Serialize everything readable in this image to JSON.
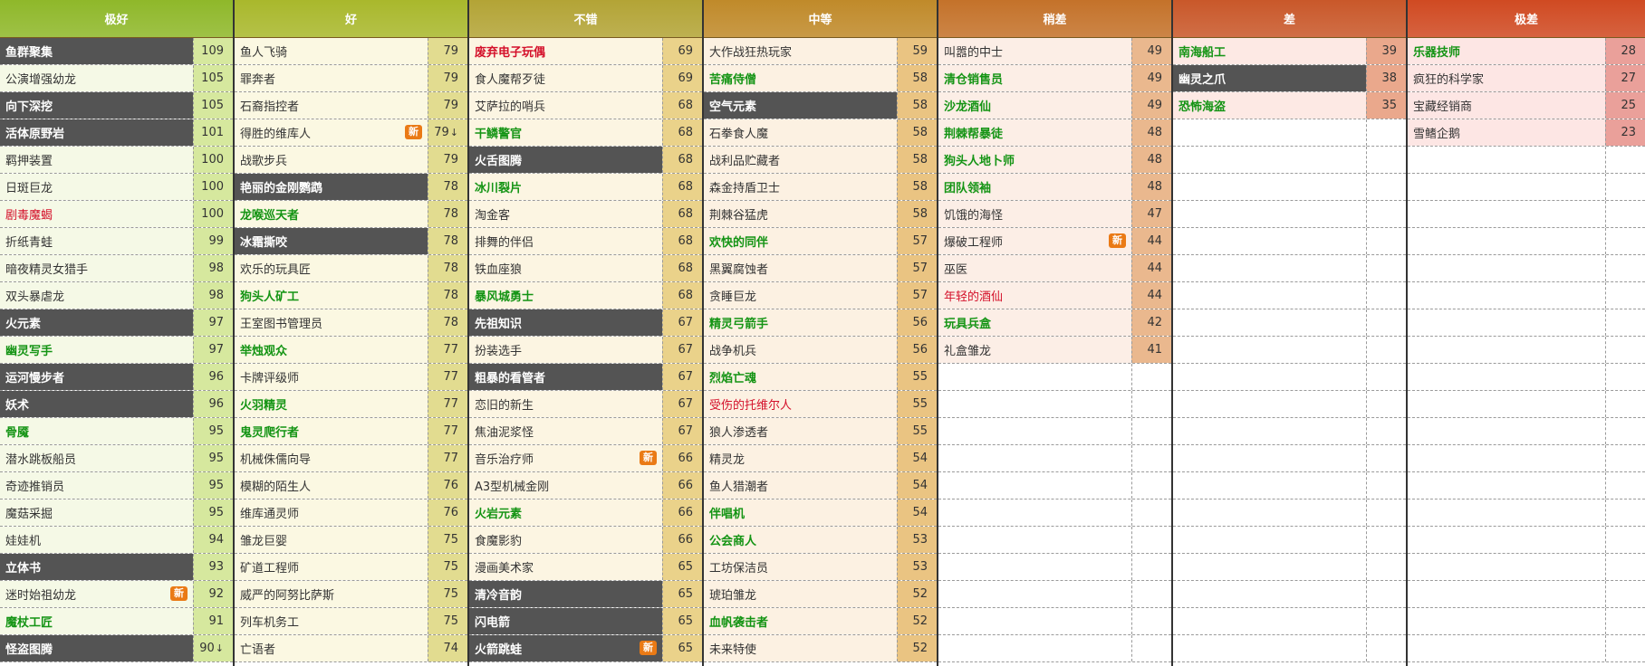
{
  "tiers": [
    {
      "label": "极好",
      "header_color": "#8fb82a",
      "name_bg": "#f5f9e6",
      "score_bg": "#d6e89e",
      "items": [
        {
          "name": "鱼群聚集",
          "score": "109",
          "style": "dark"
        },
        {
          "name": "公演增强幼龙",
          "score": "105",
          "style": ""
        },
        {
          "name": "向下深挖",
          "score": "105",
          "style": "dark"
        },
        {
          "name": "活体原野岩",
          "score": "101",
          "style": "dark"
        },
        {
          "name": "羁押装置",
          "score": "100",
          "style": ""
        },
        {
          "name": "日斑巨龙",
          "score": "100",
          "style": ""
        },
        {
          "name": "剧毒魔蝎",
          "score": "100",
          "style": "red"
        },
        {
          "name": "折纸青蛙",
          "score": "99",
          "style": ""
        },
        {
          "name": "暗夜精灵女猎手",
          "score": "98",
          "style": ""
        },
        {
          "name": "双头暴虐龙",
          "score": "98",
          "style": ""
        },
        {
          "name": "火元素",
          "score": "97",
          "style": "dark"
        },
        {
          "name": "幽灵写手",
          "score": "97",
          "style": "green"
        },
        {
          "name": "运河慢步者",
          "score": "96",
          "style": "dark"
        },
        {
          "name": "妖术",
          "score": "96",
          "style": "dark"
        },
        {
          "name": "骨魇",
          "score": "95",
          "style": "green"
        },
        {
          "name": "潜水跳板船员",
          "score": "95",
          "style": ""
        },
        {
          "name": "奇迹推销员",
          "score": "95",
          "style": ""
        },
        {
          "name": "魔菇采掘",
          "score": "95",
          "style": ""
        },
        {
          "name": "娃娃机",
          "score": "94",
          "style": ""
        },
        {
          "name": "立体书",
          "score": "93",
          "style": "dark"
        },
        {
          "name": "迷时始祖幼龙",
          "score": "92",
          "style": "",
          "badge": "新"
        },
        {
          "name": "魔杖工匠",
          "score": "91",
          "style": "green"
        },
        {
          "name": "怪盗图腾",
          "score": "90",
          "style": "dark",
          "trend": "↓"
        }
      ]
    },
    {
      "label": "好",
      "header_color": "#a9b82c",
      "name_bg": "#fbf8e2",
      "score_bg": "#e2dc90",
      "items": [
        {
          "name": "鱼人飞骑",
          "score": "79",
          "style": ""
        },
        {
          "name": "罪奔者",
          "score": "79",
          "style": ""
        },
        {
          "name": "石裔指控者",
          "score": "79",
          "style": ""
        },
        {
          "name": "得胜的维库人",
          "score": "79",
          "style": "",
          "badge": "新",
          "trend": "↓"
        },
        {
          "name": "战歌步兵",
          "score": "79",
          "style": ""
        },
        {
          "name": "艳丽的金刚鹦鹉",
          "score": "78",
          "style": "dark"
        },
        {
          "name": "龙喉巡天者",
          "score": "78",
          "style": "green"
        },
        {
          "name": "冰霜撕咬",
          "score": "78",
          "style": "dark"
        },
        {
          "name": "欢乐的玩具匠",
          "score": "78",
          "style": ""
        },
        {
          "name": "狗头人矿工",
          "score": "78",
          "style": "green"
        },
        {
          "name": "王室图书管理员",
          "score": "78",
          "style": ""
        },
        {
          "name": "举烛观众",
          "score": "77",
          "style": "green"
        },
        {
          "name": "卡牌评级师",
          "score": "77",
          "style": ""
        },
        {
          "name": "火羽精灵",
          "score": "77",
          "style": "green"
        },
        {
          "name": "鬼灵爬行者",
          "score": "77",
          "style": "green"
        },
        {
          "name": "机械侏儒向导",
          "score": "77",
          "style": ""
        },
        {
          "name": "模糊的陌生人",
          "score": "76",
          "style": ""
        },
        {
          "name": "维库通灵师",
          "score": "76",
          "style": ""
        },
        {
          "name": "雏龙巨婴",
          "score": "75",
          "style": ""
        },
        {
          "name": "矿道工程师",
          "score": "75",
          "style": ""
        },
        {
          "name": "威严的阿努比萨斯",
          "score": "75",
          "style": ""
        },
        {
          "name": "列车机务工",
          "score": "75",
          "style": ""
        },
        {
          "name": "亡语者",
          "score": "74",
          "style": ""
        }
      ]
    },
    {
      "label": "不错",
      "header_color": "#b3a436",
      "name_bg": "#fcf5e2",
      "score_bg": "#ead28a",
      "items": [
        {
          "name": "废弃电子玩偶",
          "score": "69",
          "style": "redbold"
        },
        {
          "name": "食人魔帮歹徒",
          "score": "69",
          "style": ""
        },
        {
          "name": "艾萨拉的哨兵",
          "score": "68",
          "style": ""
        },
        {
          "name": "干鳞警官",
          "score": "68",
          "style": "green"
        },
        {
          "name": "火舌图腾",
          "score": "68",
          "style": "dark"
        },
        {
          "name": "冰川裂片",
          "score": "68",
          "style": "green"
        },
        {
          "name": "淘金客",
          "score": "68",
          "style": ""
        },
        {
          "name": "排舞的伴侣",
          "score": "68",
          "style": ""
        },
        {
          "name": "铁血座狼",
          "score": "68",
          "style": ""
        },
        {
          "name": "暴风城勇士",
          "score": "68",
          "style": "green"
        },
        {
          "name": "先祖知识",
          "score": "67",
          "style": "dark"
        },
        {
          "name": "扮装选手",
          "score": "67",
          "style": ""
        },
        {
          "name": "粗暴的看管者",
          "score": "67",
          "style": "dark"
        },
        {
          "name": "恋旧的新生",
          "score": "67",
          "style": ""
        },
        {
          "name": "焦油泥浆怪",
          "score": "67",
          "style": ""
        },
        {
          "name": "音乐治疗师",
          "score": "66",
          "style": "",
          "badge": "新"
        },
        {
          "name": "A3型机械金刚",
          "score": "66",
          "style": ""
        },
        {
          "name": "火岩元素",
          "score": "66",
          "style": "green"
        },
        {
          "name": "食魔影豹",
          "score": "66",
          "style": ""
        },
        {
          "name": "漫画美术家",
          "score": "65",
          "style": ""
        },
        {
          "name": "清冷音韵",
          "score": "65",
          "style": "dark"
        },
        {
          "name": "闪电箭",
          "score": "65",
          "style": "dark"
        },
        {
          "name": "火箭跳蛙",
          "score": "65",
          "style": "dark",
          "badge": "新"
        }
      ]
    },
    {
      "label": "中等",
      "header_color": "#c08a2a",
      "name_bg": "#fcf1e2",
      "score_bg": "#eac482",
      "items": [
        {
          "name": "大作战狂热玩家",
          "score": "59",
          "style": ""
        },
        {
          "name": "苦痛侍僧",
          "score": "58",
          "style": "green"
        },
        {
          "name": "空气元素",
          "score": "58",
          "style": "dark"
        },
        {
          "name": "石拳食人魔",
          "score": "58",
          "style": ""
        },
        {
          "name": "战利品贮藏者",
          "score": "58",
          "style": ""
        },
        {
          "name": "森金持盾卫士",
          "score": "58",
          "style": ""
        },
        {
          "name": "荆棘谷猛虎",
          "score": "58",
          "style": ""
        },
        {
          "name": "欢快的同伴",
          "score": "57",
          "style": "green"
        },
        {
          "name": "黑翼腐蚀者",
          "score": "57",
          "style": ""
        },
        {
          "name": "贪睡巨龙",
          "score": "57",
          "style": ""
        },
        {
          "name": "精灵弓箭手",
          "score": "56",
          "style": "green"
        },
        {
          "name": "战争机兵",
          "score": "56",
          "style": ""
        },
        {
          "name": "烈焰亡魂",
          "score": "55",
          "style": "green"
        },
        {
          "name": "受伤的托维尔人",
          "score": "55",
          "style": "red"
        },
        {
          "name": "狼人渗透者",
          "score": "55",
          "style": ""
        },
        {
          "name": "精灵龙",
          "score": "54",
          "style": ""
        },
        {
          "name": "鱼人猎潮者",
          "score": "54",
          "style": ""
        },
        {
          "name": "伴唱机",
          "score": "54",
          "style": "green"
        },
        {
          "name": "公会商人",
          "score": "53",
          "style": "green"
        },
        {
          "name": "工坊保洁员",
          "score": "53",
          "style": ""
        },
        {
          "name": "琥珀雏龙",
          "score": "52",
          "style": ""
        },
        {
          "name": "血帆袭击者",
          "score": "52",
          "style": "green"
        },
        {
          "name": "未来特使",
          "score": "52",
          "style": ""
        }
      ]
    },
    {
      "label": "稍差",
      "header_color": "#c4722a",
      "name_bg": "#fceee6",
      "score_bg": "#eab88e",
      "items": [
        {
          "name": "叫嚣的中士",
          "score": "49",
          "style": ""
        },
        {
          "name": "清仓销售员",
          "score": "49",
          "style": "green"
        },
        {
          "name": "沙龙酒仙",
          "score": "49",
          "style": "green"
        },
        {
          "name": "荆棘帮暴徒",
          "score": "48",
          "style": "green"
        },
        {
          "name": "狗头人地卜师",
          "score": "48",
          "style": "green"
        },
        {
          "name": "团队领袖",
          "score": "48",
          "style": "green"
        },
        {
          "name": "饥饿的海怪",
          "score": "47",
          "style": ""
        },
        {
          "name": "爆破工程师",
          "score": "44",
          "style": "",
          "badge": "新"
        },
        {
          "name": "巫医",
          "score": "44",
          "style": ""
        },
        {
          "name": "年轻的酒仙",
          "score": "44",
          "style": "red"
        },
        {
          "name": "玩具兵盒",
          "score": "42",
          "style": "green"
        },
        {
          "name": "礼盒雏龙",
          "score": "41",
          "style": ""
        }
      ]
    },
    {
      "label": "差",
      "header_color": "#c9582a",
      "name_bg": "#fde9e4",
      "score_bg": "#eaa88c",
      "items": [
        {
          "name": "南海船工",
          "score": "39",
          "style": "green"
        },
        {
          "name": "幽灵之爪",
          "score": "38",
          "style": "dark"
        },
        {
          "name": "恐怖海盗",
          "score": "35",
          "style": "green"
        }
      ]
    },
    {
      "label": "极差",
      "header_color": "#d04a22",
      "name_bg": "#fde6e4",
      "score_bg": "#eaa09a",
      "items": [
        {
          "name": "乐器技师",
          "score": "28",
          "style": "green"
        },
        {
          "name": "疯狂的科学家",
          "score": "27",
          "style": ""
        },
        {
          "name": "宝藏经销商",
          "score": "25",
          "style": ""
        },
        {
          "name": "雪鳍企鹅",
          "score": "23",
          "style": ""
        }
      ]
    }
  ]
}
